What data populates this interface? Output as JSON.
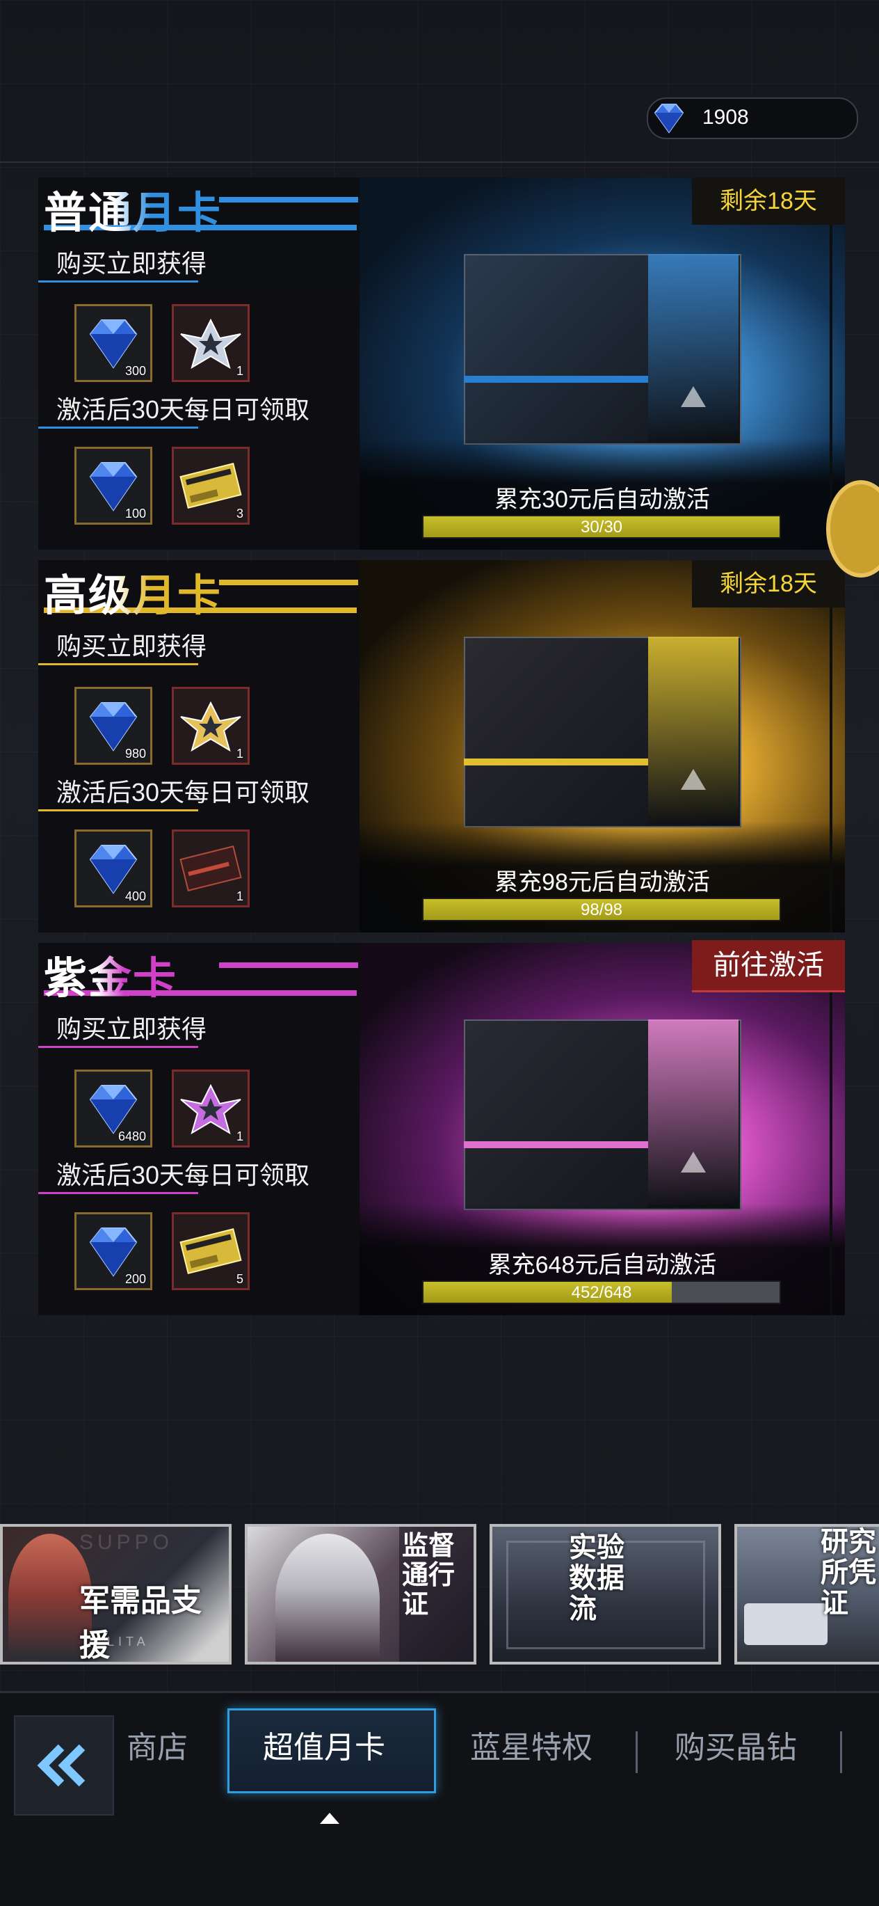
{
  "currency": {
    "amount": "1908",
    "icon": "diamond-icon"
  },
  "cards": [
    {
      "title": "普通月卡",
      "accent": "#2f8fe0",
      "section_instant": "购买立即获得",
      "instant_items": [
        {
          "icon": "diamond-icon",
          "qty": "300"
        },
        {
          "icon": "rank-badge-silver-icon",
          "qty": "1"
        }
      ],
      "section_daily": "激活后30天每日可领取",
      "daily_items": [
        {
          "icon": "diamond-icon",
          "qty": "100"
        },
        {
          "icon": "license-ticket-gold-icon",
          "qty": "3"
        }
      ],
      "status": "剩余18天",
      "condition": "累充30元后自动激活",
      "progress_text": "30/30",
      "progress": 1.0
    },
    {
      "title": "高级月卡",
      "accent": "#e0b82a",
      "section_instant": "购买立即获得",
      "instant_items": [
        {
          "icon": "diamond-icon",
          "qty": "980"
        },
        {
          "icon": "rank-badge-gold-icon",
          "qty": "1"
        }
      ],
      "section_daily": "激活后30天每日可领取",
      "daily_items": [
        {
          "icon": "diamond-icon",
          "qty": "400"
        },
        {
          "icon": "license-ticket-red-icon",
          "qty": "1"
        }
      ],
      "status": "剩余18天",
      "condition": "累充98元后自动激活",
      "progress_text": "98/98",
      "progress": 1.0
    },
    {
      "title": "紫金卡",
      "accent": "#d040c8",
      "section_instant": "购买立即获得",
      "instant_items": [
        {
          "icon": "diamond-icon",
          "qty": "6480"
        },
        {
          "icon": "rank-badge-purple-icon",
          "qty": "1"
        }
      ],
      "section_daily": "激活后30天每日可领取",
      "daily_items": [
        {
          "icon": "diamond-icon",
          "qty": "200"
        },
        {
          "icon": "license-ticket-gold-icon",
          "qty": "5"
        }
      ],
      "status": "前往激活",
      "condition": "累充648元后自动激活",
      "progress_text": "452/648",
      "progress": 0.6975
    }
  ],
  "promos": [
    {
      "text": "军需品支援",
      "bg_text": "SUPPO",
      "sub": "LITA"
    },
    {
      "text": "监督通行证"
    },
    {
      "text": "实验数据流"
    },
    {
      "text": "研究所凭证"
    }
  ],
  "nav": {
    "back_icon": "double-chevron-left-icon",
    "tabs": [
      "商店",
      "超值月卡",
      "蓝星特权",
      "购买晶钻"
    ],
    "active_index": 1
  }
}
